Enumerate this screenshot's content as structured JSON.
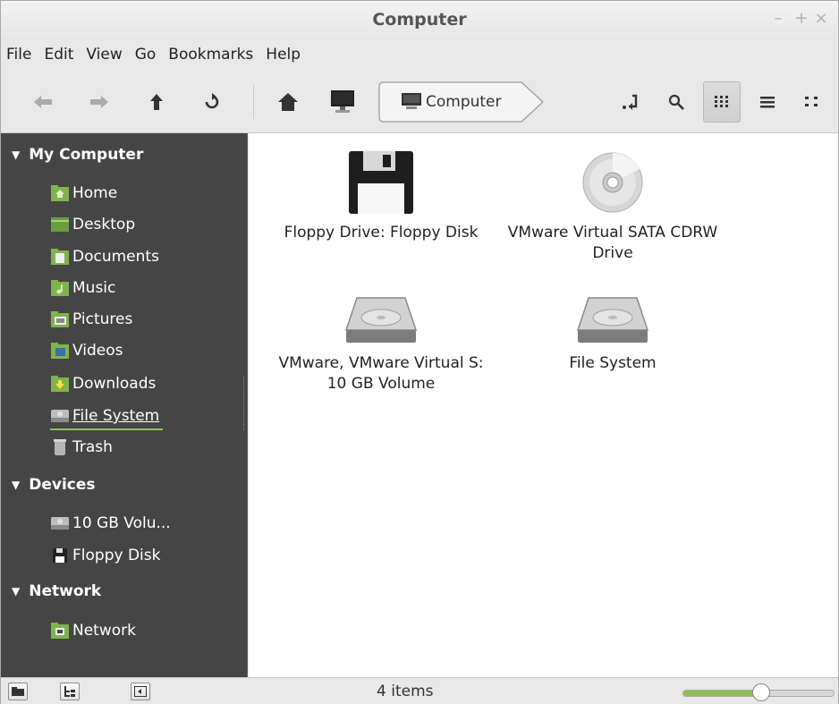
{
  "window": {
    "title": "Computer"
  },
  "wm": {
    "minimize": "–",
    "maximize": "+",
    "close": "×"
  },
  "menubar": [
    "File",
    "Edit",
    "View",
    "Go",
    "Bookmarks",
    "Help"
  ],
  "toolbar": {
    "back_icon": "arrow-left-icon",
    "forward_icon": "arrow-right-icon",
    "up_icon": "arrow-up-icon",
    "reload_icon": "reload-icon",
    "home_icon": "home-icon",
    "computer_icon": "computer-icon",
    "path_label": "Computer",
    "views": [
      "icon-view",
      "list-view",
      "compact-view"
    ]
  },
  "sidebar": {
    "sections": [
      {
        "label": "My Computer"
      },
      {
        "label": "Devices"
      },
      {
        "label": "Network"
      }
    ],
    "my_computer": [
      "Home",
      "Desktop",
      "Documents",
      "Music",
      "Pictures",
      "Videos",
      "Downloads",
      "File System",
      "Trash"
    ],
    "devices": [
      "10 GB Volu...",
      "Floppy Disk"
    ],
    "network": [
      "Network"
    ],
    "selected": "File System"
  },
  "files": [
    {
      "label": "Floppy Drive: Floppy Disk",
      "icon": "floppy-icon"
    },
    {
      "label": "VMware Virtual SATA CDRW Drive",
      "icon": "cdrom-icon"
    },
    {
      "label": "VMware, VMware Virtual S: 10 GB Volume",
      "icon": "harddisk-icon"
    },
    {
      "label": "File System",
      "icon": "harddisk-icon"
    }
  ],
  "statusbar": {
    "text": "4 items",
    "zoom_level": 0.52
  },
  "colors": {
    "accent": "#8cc04f",
    "sidebar_bg": "#454545"
  }
}
